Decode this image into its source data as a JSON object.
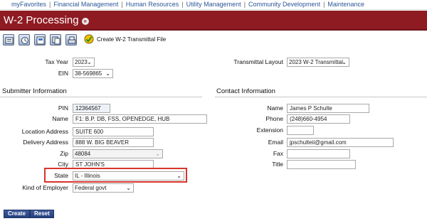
{
  "topnav": {
    "items": [
      "myFavorites",
      "Financial Management",
      "Human Resources",
      "Utility Management",
      "Community Development",
      "Maintenance"
    ]
  },
  "header": {
    "title": "W-2 Processing"
  },
  "toolbar": {
    "icons": [
      "printer-report-icon",
      "process-icon",
      "preview-icon",
      "copy-icon",
      "print-icon"
    ],
    "create_file_label": "Create W-2 Transmittal File"
  },
  "top_fields": {
    "tax_year": {
      "label": "Tax Year",
      "value": "2023"
    },
    "ein": {
      "label": "EIN",
      "value": "38-569865"
    },
    "transmittal_layout": {
      "label": "Transmittal Layout",
      "value": "2023 W-2 Transmittal"
    }
  },
  "submitter": {
    "section_title": "Submitter Information",
    "pin": {
      "label": "PIN",
      "value": "12364567"
    },
    "name": {
      "label": "Name",
      "value": "F1: B.P. DB, FSS, OPENEDGE, HUB"
    },
    "location_address": {
      "label": "Location Address",
      "value": "SUITE 600"
    },
    "delivery_address": {
      "label": "Delivery Address",
      "value": "888 W. BIG BEAVER"
    },
    "zip": {
      "label": "Zip",
      "value": "48084"
    },
    "city": {
      "label": "City",
      "value": "ST JOHN'S"
    },
    "state": {
      "label": "State",
      "value": "IL - Illinois"
    },
    "kind_of_employer": {
      "label": "Kind of Employer",
      "value": "Federal govt"
    }
  },
  "contact": {
    "section_title": "Contact Information",
    "name": {
      "label": "Name",
      "value": "James P Schulte"
    },
    "phone": {
      "label": "Phone",
      "value": "(248)660-4954"
    },
    "extension": {
      "label": "Extension",
      "value": ""
    },
    "email": {
      "label": "Email",
      "value": "jpschulteii@gmail.com"
    },
    "fax": {
      "label": "Fax",
      "value": ""
    },
    "title": {
      "label": "Title",
      "value": ""
    }
  },
  "actions": {
    "create_label": "Create",
    "reset_label": "Reset"
  },
  "colors": {
    "header_bg": "#8f1b22",
    "button_bg": "#2d4a8c",
    "highlight_border": "#d9332b",
    "link": "#2b5797"
  }
}
